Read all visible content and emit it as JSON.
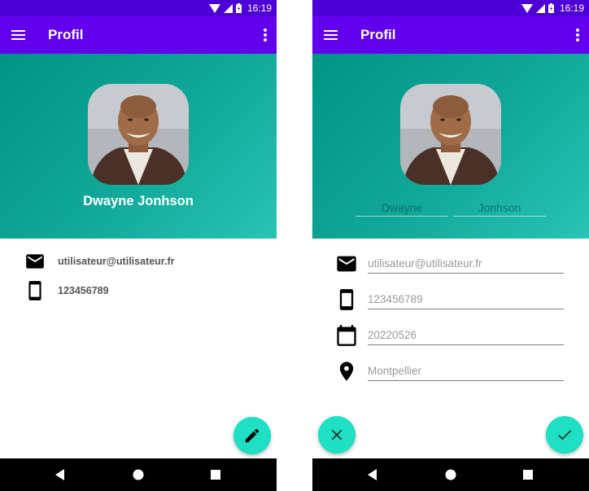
{
  "status_bar": {
    "time": "16:19"
  },
  "colors": {
    "status_bar": "#4d00d6",
    "app_bar": "#6200ee",
    "header_start": "#009485",
    "header_end": "#29c4b7",
    "fab": "#1de0c4",
    "nav_bar": "#000000"
  },
  "view_screen": {
    "app_bar": {
      "title": "Profil",
      "menu_icon": "hamburger-menu-icon",
      "overflow_icon": "more-vert-icon"
    },
    "profile": {
      "avatar": "profile-photo",
      "full_name": "Dwayne Jonhson"
    },
    "details": [
      {
        "icon": "email-icon",
        "value": "utilisateur@utilisateur.fr"
      },
      {
        "icon": "smartphone-icon",
        "value": "123456789"
      }
    ],
    "fab_icon": "pencil-edit-icon"
  },
  "edit_screen": {
    "app_bar": {
      "title": "Profil",
      "menu_icon": "hamburger-menu-icon",
      "overflow_icon": "more-vert-icon"
    },
    "profile": {
      "avatar": "profile-photo"
    },
    "first_name": {
      "placeholder": "Dwayne",
      "value": ""
    },
    "last_name": {
      "placeholder": "Jonhson",
      "value": ""
    },
    "fields": [
      {
        "icon": "email-icon",
        "placeholder": "utilisateur@utilisateur.fr",
        "value": ""
      },
      {
        "icon": "smartphone-icon",
        "placeholder": "123456789",
        "value": ""
      },
      {
        "icon": "calendar-icon",
        "placeholder": "20220526",
        "value": ""
      },
      {
        "icon": "location-pin-icon",
        "placeholder": "Montpellier",
        "value": ""
      }
    ],
    "cancel_icon": "close-icon",
    "confirm_icon": "check-icon"
  },
  "nav_bar": {
    "icons": [
      "back-triangle-icon",
      "home-circle-icon",
      "recents-square-icon"
    ]
  }
}
